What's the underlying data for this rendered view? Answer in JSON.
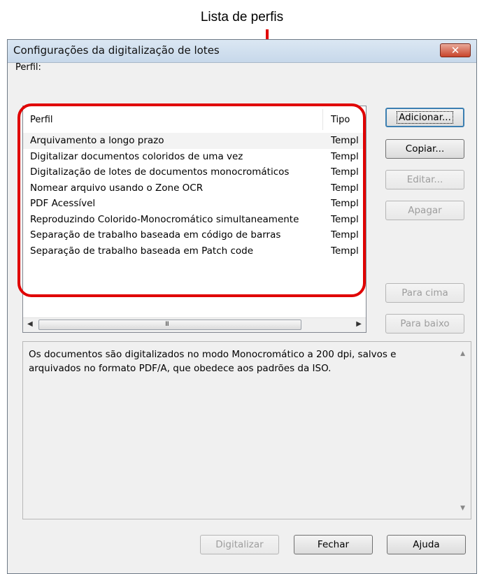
{
  "callout": {
    "label": "Lista de perfis",
    "color": "#e00000"
  },
  "window": {
    "title": "Configurações da digitalização de lotes",
    "close_glyph": "✕"
  },
  "profile_section": {
    "label": "Perfil:"
  },
  "profile_list": {
    "columns": {
      "name": "Perfil",
      "type": "Tipo"
    },
    "rows": [
      {
        "name": "Arquivamento a longo prazo",
        "type": "Templ"
      },
      {
        "name": "Digitalizar documentos coloridos de uma vez",
        "type": "Templ"
      },
      {
        "name": "Digitalização de lotes de documentos monocromáticos",
        "type": "Templ"
      },
      {
        "name": "Nomear arquivo usando o Zone OCR",
        "type": "Templ"
      },
      {
        "name": "PDF Acessível",
        "type": "Templ"
      },
      {
        "name": "Reproduzindo Colorido-Monocromático simultaneamente",
        "type": "Templ"
      },
      {
        "name": "Separação de trabalho baseada em código de barras",
        "type": "Templ"
      },
      {
        "name": "Separação de trabalho baseada em Patch code",
        "type": "Templ"
      }
    ],
    "scrollbar": {
      "left_arrow": "◀",
      "right_arrow": "▶",
      "grip": "III"
    }
  },
  "side_buttons": {
    "add": "Adicionar...",
    "copy": "Copiar...",
    "edit": "Editar...",
    "delete": "Apagar",
    "move_up": "Para cima",
    "move_down": "Para baixo"
  },
  "description": {
    "text": "Os documentos são digitalizados no modo Monocromático a 200 dpi,  salvos e arquivados no formato PDF/A, que obedece aos padrões da ISO.",
    "scroll_up": "▲",
    "scroll_down": "▼"
  },
  "footer_buttons": {
    "scan": "Digitalizar",
    "close": "Fechar",
    "help": "Ajuda"
  }
}
